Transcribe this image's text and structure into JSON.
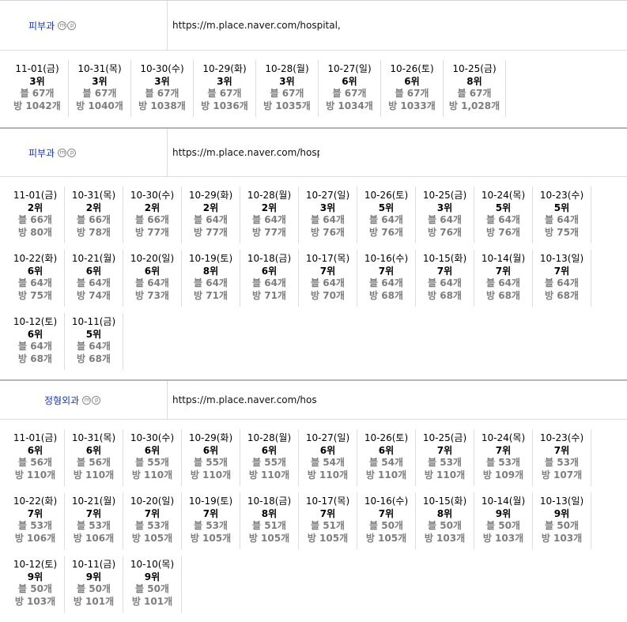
{
  "sections": [
    {
      "category": "피부과",
      "mp": [
        "m",
        "p"
      ],
      "url": "https://m.place.naver.com/hospital,",
      "days": [
        {
          "date": "11-01(금)",
          "rank": "3위",
          "blog": "블 67개",
          "place": "방 1042개"
        },
        {
          "date": "10-31(목)",
          "rank": "3위",
          "blog": "블 67개",
          "place": "방 1040개"
        },
        {
          "date": "10-30(수)",
          "rank": "3위",
          "blog": "블 67개",
          "place": "방 1038개"
        },
        {
          "date": "10-29(화)",
          "rank": "3위",
          "blog": "블 67개",
          "place": "방 1036개"
        },
        {
          "date": "10-28(월)",
          "rank": "3위",
          "blog": "블 67개",
          "place": "방 1035개"
        },
        {
          "date": "10-27(일)",
          "rank": "6위",
          "blog": "블 67개",
          "place": "방 1034개"
        },
        {
          "date": "10-26(토)",
          "rank": "6위",
          "blog": "블 67개",
          "place": "방 1033개"
        },
        {
          "date": "10-25(금)",
          "rank": "8위",
          "blog": "블 67개",
          "place": "방 1,028개"
        }
      ]
    },
    {
      "category": "피부과",
      "mp": [
        "m",
        "p"
      ],
      "url": "https://m.place.naver.com/hospital",
      "days": [
        {
          "date": "11-01(금)",
          "rank": "2위",
          "blog": "블 66개",
          "place": "방 80개"
        },
        {
          "date": "10-31(목)",
          "rank": "2위",
          "blog": "블 66개",
          "place": "방 78개"
        },
        {
          "date": "10-30(수)",
          "rank": "2위",
          "blog": "블 66개",
          "place": "방 77개"
        },
        {
          "date": "10-29(화)",
          "rank": "2위",
          "blog": "블 64개",
          "place": "방 77개"
        },
        {
          "date": "10-28(월)",
          "rank": "2위",
          "blog": "블 64개",
          "place": "방 77개"
        },
        {
          "date": "10-27(일)",
          "rank": "3위",
          "blog": "블 64개",
          "place": "방 76개"
        },
        {
          "date": "10-26(토)",
          "rank": "5위",
          "blog": "블 64개",
          "place": "방 76개"
        },
        {
          "date": "10-25(금)",
          "rank": "3위",
          "blog": "블 64개",
          "place": "방 76개"
        },
        {
          "date": "10-24(목)",
          "rank": "5위",
          "blog": "블 64개",
          "place": "방 76개"
        },
        {
          "date": "10-23(수)",
          "rank": "5위",
          "blog": "블 64개",
          "place": "방 75개"
        },
        {
          "date": "10-22(화)",
          "rank": "6위",
          "blog": "블 64개",
          "place": "방 75개"
        },
        {
          "date": "10-21(월)",
          "rank": "6위",
          "blog": "블 64개",
          "place": "방 74개"
        },
        {
          "date": "10-20(일)",
          "rank": "6위",
          "blog": "블 64개",
          "place": "방 73개"
        },
        {
          "date": "10-19(토)",
          "rank": "8위",
          "blog": "블 64개",
          "place": "방 71개"
        },
        {
          "date": "10-18(금)",
          "rank": "6위",
          "blog": "블 64개",
          "place": "방 71개"
        },
        {
          "date": "10-17(목)",
          "rank": "7위",
          "blog": "블 64개",
          "place": "방 70개"
        },
        {
          "date": "10-16(수)",
          "rank": "7위",
          "blog": "블 64개",
          "place": "방 68개"
        },
        {
          "date": "10-15(화)",
          "rank": "7위",
          "blog": "블 64개",
          "place": "방 68개"
        },
        {
          "date": "10-14(월)",
          "rank": "7위",
          "blog": "블 64개",
          "place": "방 68개"
        },
        {
          "date": "10-13(일)",
          "rank": "7위",
          "blog": "블 64개",
          "place": "방 68개"
        },
        {
          "date": "10-12(토)",
          "rank": "6위",
          "blog": "블 64개",
          "place": "방 68개"
        },
        {
          "date": "10-11(금)",
          "rank": "5위",
          "blog": "블 64개",
          "place": "방 68개"
        }
      ]
    },
    {
      "category": "정형외과",
      "mp": [
        "m",
        "p"
      ],
      "url": "https://m.place.naver.com/hospita",
      "days": [
        {
          "date": "11-01(금)",
          "rank": "6위",
          "blog": "블 56개",
          "place": "방 110개"
        },
        {
          "date": "10-31(목)",
          "rank": "6위",
          "blog": "블 56개",
          "place": "방 110개"
        },
        {
          "date": "10-30(수)",
          "rank": "6위",
          "blog": "블 55개",
          "place": "방 110개"
        },
        {
          "date": "10-29(화)",
          "rank": "6위",
          "blog": "블 55개",
          "place": "방 110개"
        },
        {
          "date": "10-28(월)",
          "rank": "6위",
          "blog": "블 55개",
          "place": "방 110개"
        },
        {
          "date": "10-27(일)",
          "rank": "6위",
          "blog": "블 54개",
          "place": "방 110개"
        },
        {
          "date": "10-26(토)",
          "rank": "6위",
          "blog": "블 54개",
          "place": "방 110개"
        },
        {
          "date": "10-25(금)",
          "rank": "7위",
          "blog": "블 53개",
          "place": "방 110개"
        },
        {
          "date": "10-24(목)",
          "rank": "7위",
          "blog": "블 53개",
          "place": "방 109개"
        },
        {
          "date": "10-23(수)",
          "rank": "7위",
          "blog": "블 53개",
          "place": "방 107개"
        },
        {
          "date": "10-22(화)",
          "rank": "7위",
          "blog": "블 53개",
          "place": "방 106개"
        },
        {
          "date": "10-21(월)",
          "rank": "7위",
          "blog": "블 53개",
          "place": "방 106개"
        },
        {
          "date": "10-20(일)",
          "rank": "7위",
          "blog": "블 53개",
          "place": "방 105개"
        },
        {
          "date": "10-19(토)",
          "rank": "7위",
          "blog": "블 53개",
          "place": "방 105개"
        },
        {
          "date": "10-18(금)",
          "rank": "8위",
          "blog": "블 51개",
          "place": "방 105개"
        },
        {
          "date": "10-17(목)",
          "rank": "7위",
          "blog": "블 51개",
          "place": "방 105개"
        },
        {
          "date": "10-16(수)",
          "rank": "7위",
          "blog": "블 50개",
          "place": "방 105개"
        },
        {
          "date": "10-15(화)",
          "rank": "8위",
          "blog": "블 50개",
          "place": "방 103개"
        },
        {
          "date": "10-14(월)",
          "rank": "9위",
          "blog": "블 50개",
          "place": "방 103개"
        },
        {
          "date": "10-13(일)",
          "rank": "9위",
          "blog": "블 50개",
          "place": "방 103개"
        },
        {
          "date": "10-12(토)",
          "rank": "9위",
          "blog": "블 50개",
          "place": "방 103개"
        },
        {
          "date": "10-11(금)",
          "rank": "9위",
          "blog": "블 50개",
          "place": "방 101개"
        },
        {
          "date": "10-10(목)",
          "rank": "9위",
          "blog": "블 50개",
          "place": "방 101개"
        }
      ]
    }
  ]
}
